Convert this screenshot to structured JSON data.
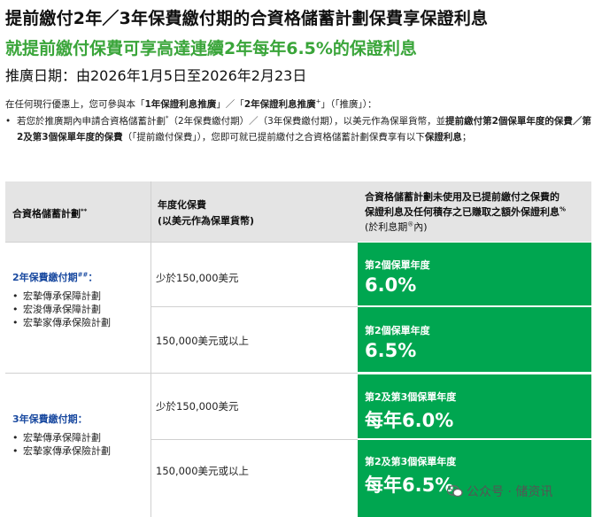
{
  "titles": {
    "line1": "提前繳付2年／3年保費繳付期的合資格儲蓄計劃保費享保證利息",
    "line2": "就提前繳付保費可享高達連續2年每年6.5%的保證利息",
    "period": "推廣日期：由2026年1月5日至2026年2月23日"
  },
  "intro": {
    "p1": "在任何現行優惠上，您可參與本「",
    "p1_b1": "1年保證利息推廣",
    "p1_mid": "」／「",
    "p1_b2": "2年保證利息推廣",
    "p1_sup": "+",
    "p1_end": "」（「推廣」）：",
    "bullet_dot": "•",
    "b1": "若您於推廣期內申請合資格儲蓄計劃",
    "b1_sup": "*",
    "b2": "（2年保費繳付期）／（3年保費繳付期），以美元作為保單貨幣，並",
    "b3_bold": "提前繳付第2個保單年度的保費",
    "b4": "／",
    "b5_bold": "第2及第3個保單年度的保費",
    "b6": "（「提前繳付保費」），您即可就已提前繳付之合資格儲蓄計劃保費享有以下",
    "b7_bold": "保證利息",
    "b8": "；"
  },
  "table": {
    "headers": {
      "col1": "合資格儲蓄計劃",
      "col1_sup": "**",
      "col2_l1": "年度化保費",
      "col2_l2": "(以美元作為保單貨幣)",
      "col3_l1": "合資格儲蓄計劃未使用及已提前繳付之保費的",
      "col3_l2": "保證利息及任何積存之已賺取之額外保證利息",
      "col3_sup": "%",
      "col3_l3": "(於利息期",
      "col3_l3_sup": "®",
      "col3_l3_end": "內)"
    },
    "groups": [
      {
        "label": "2年保費繳付期",
        "label_sup": "##",
        "label_end": "：",
        "plans": [
          "宏摯傳承保障計劃",
          "宏浚傳承保障計劃",
          "宏摯家傳承保險計劃"
        ],
        "rows": [
          {
            "premium": "少於150,000美元",
            "year_label": "第2個保單年度",
            "rate": "6.0%"
          },
          {
            "premium": "150,000美元或以上",
            "year_label": "第2個保單年度",
            "rate": "6.5%"
          }
        ]
      },
      {
        "label": "3年保費繳付期",
        "label_sup": "",
        "label_end": "：",
        "plans": [
          "宏摯傳承保障計劃",
          "宏摯家傳承保險計劃"
        ],
        "rows": [
          {
            "premium": "少於150,000美元",
            "year_label": "第2及第3個保單年度",
            "rate": "每年6.0%"
          },
          {
            "premium": "150,000美元或以上",
            "year_label": "第2及第3個保單年度",
            "rate": "每年6.5%"
          }
        ]
      }
    ]
  },
  "watermark": {
    "text": "公众号 · 储资讯",
    "icon": "wechat-icon"
  },
  "colors": {
    "green_title": "#3aa53a",
    "green_cell": "#00a650",
    "blue_label": "#1a4aa0",
    "header_bg": "#e4e4e4"
  }
}
